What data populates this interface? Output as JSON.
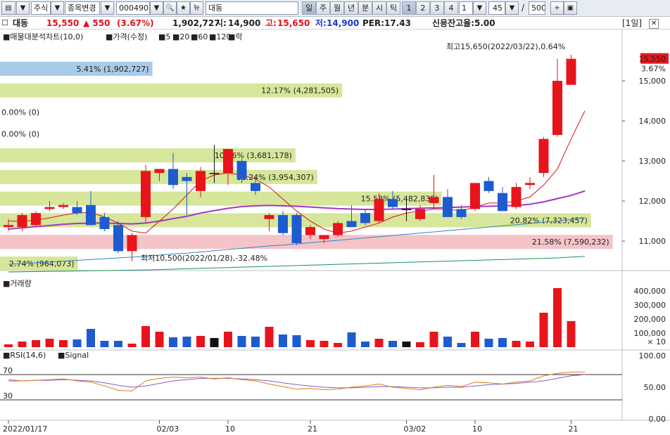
{
  "toolbar": {
    "market": "주식",
    "change_label": "종목변경",
    "code": "000490",
    "name": "대동",
    "periods": [
      "일",
      "주",
      "월",
      "년",
      "분",
      "시",
      "틱"
    ],
    "counts": [
      "1",
      "2",
      "3",
      "4"
    ],
    "interval_value": "1",
    "span_value": "45",
    "separator": "/",
    "total_value": "500"
  },
  "info": {
    "name": "대동",
    "price": "15,550",
    "change": "▲ 550",
    "change_pct": "(3.67%)",
    "volume": "1,902,727",
    "open_label": "시:",
    "open": "14,900",
    "high_label": "고:",
    "high": "15,650",
    "low_label": "저:",
    "low": "14,900",
    "per": "PER:17.43",
    "credit": "신용잔고율:5.00",
    "period_tag": "[1일]"
  },
  "legend": {
    "title": "매물대분석차트(10,0)",
    "price_label": "가격(수정)",
    "ma5": "5",
    "ma20": "20",
    "ma60": "60",
    "ma120": "120",
    "extra": "락"
  },
  "colors": {
    "up": "#e8141c",
    "down": "#1e5bd1",
    "ma5": "#d9141b",
    "ma20": "#a237c4",
    "ma60": "#2f86c6",
    "ma120": "#1a8f5d",
    "zone_green": "#d6e69a",
    "zone_red": "#f4c4c8",
    "zone_blue": "#a9cbe8"
  },
  "price_axis": {
    "ticks": [
      "15,000",
      "14,000",
      "13,000",
      "12,000",
      "11,000"
    ],
    "current": "15,550",
    "current_pct": "3.67%"
  },
  "volume_panel": {
    "title": "거래량",
    "ticks": [
      "400,000",
      "300,000",
      "200,000",
      "100,000"
    ],
    "unit": "× 10"
  },
  "rsi_panel": {
    "title": "RSI(14,6)",
    "signal": "Signal",
    "ticks": [
      "100.00",
      "50.00",
      "0.00"
    ],
    "upper": "70",
    "lower": "30"
  },
  "annotations": {
    "high": "최고15,650(2022/03/22),0.64%",
    "low": "최저10,500(2022/01/28),-32.48%"
  },
  "date_labels": [
    "2022/01/17",
    "02/03",
    "10",
    "21",
    "03/02",
    "10",
    "21"
  ],
  "chart_data": {
    "type": "candlestick",
    "price_range": [
      10300,
      16000
    ],
    "volume_range": [
      0,
      450000
    ],
    "rsi_range": [
      0,
      100
    ],
    "profile": [
      {
        "label": "5.41% (1,902,727)",
        "price": 15300,
        "width": 0.245,
        "color": "blue"
      },
      {
        "label": "12.17% (4,281,505)",
        "price": 14760,
        "width": 0.55,
        "color": "green"
      },
      {
        "label": "0.00% (0)",
        "price": 14220,
        "width": 0,
        "color": "green"
      },
      {
        "label": "0.00% (0)",
        "price": 13680,
        "width": 0,
        "color": "green"
      },
      {
        "label": "10.46% (3,681,178)",
        "price": 13140,
        "width": 0.475,
        "color": "green"
      },
      {
        "label": "11.24% (3,954,307)",
        "price": 12600,
        "width": 0.51,
        "color": "green"
      },
      {
        "label": "15.58% (5,482,835)",
        "price": 12060,
        "width": 0.71,
        "color": "green"
      },
      {
        "label": "20.82% (7,323,457)",
        "price": 11520,
        "width": 0.95,
        "color": "green"
      },
      {
        "label": "21.58% (7,590,232)",
        "price": 10980,
        "width": 0.985,
        "color": "red"
      },
      {
        "label": "2.74% (964,073)",
        "price": 10440,
        "width": 0.125,
        "color": "green"
      }
    ],
    "candles": [
      {
        "o": 11350,
        "h": 11550,
        "l": 11250,
        "c": 11400,
        "v": 20000
      },
      {
        "o": 11350,
        "h": 11700,
        "l": 11250,
        "c": 11650,
        "v": 40000
      },
      {
        "o": 11400,
        "h": 11750,
        "l": 11350,
        "c": 11700,
        "v": 50000
      },
      {
        "o": 11800,
        "h": 12000,
        "l": 11750,
        "c": 11850,
        "v": 60000
      },
      {
        "o": 11850,
        "h": 11950,
        "l": 11800,
        "c": 11900,
        "v": 50000
      },
      {
        "o": 11850,
        "h": 12000,
        "l": 11650,
        "c": 11700,
        "v": 55000
      },
      {
        "o": 11900,
        "h": 12250,
        "l": 11500,
        "c": 11400,
        "v": 130000
      },
      {
        "o": 11600,
        "h": 11700,
        "l": 11250,
        "c": 11300,
        "v": 45000
      },
      {
        "o": 11400,
        "h": 11500,
        "l": 10700,
        "c": 10750,
        "v": 45000
      },
      {
        "o": 10750,
        "h": 11200,
        "l": 10500,
        "c": 11150,
        "v": 25000
      },
      {
        "o": 11600,
        "h": 12900,
        "l": 11450,
        "c": 12750,
        "v": 150000
      },
      {
        "o": 12700,
        "h": 12800,
        "l": 12500,
        "c": 12800,
        "v": 110000
      },
      {
        "o": 12800,
        "h": 13200,
        "l": 12300,
        "c": 12400,
        "v": 70000
      },
      {
        "o": 12600,
        "h": 12700,
        "l": 11650,
        "c": 12500,
        "v": 75000
      },
      {
        "o": 12250,
        "h": 12850,
        "l": 12100,
        "c": 12750,
        "v": 80000
      },
      {
        "o": 12700,
        "h": 13400,
        "l": 12450,
        "c": 12700,
        "v": 65000
      },
      {
        "o": 12700,
        "h": 13300,
        "l": 12400,
        "c": 13300,
        "v": 110000
      },
      {
        "o": 13000,
        "h": 13050,
        "l": 12450,
        "c": 12550,
        "v": 80000
      },
      {
        "o": 12450,
        "h": 12650,
        "l": 12150,
        "c": 12250,
        "v": 75000
      },
      {
        "o": 11550,
        "h": 11700,
        "l": 11250,
        "c": 11650,
        "v": 145000
      },
      {
        "o": 11650,
        "h": 11750,
        "l": 11150,
        "c": 11200,
        "v": 90000
      },
      {
        "o": 11650,
        "h": 11700,
        "l": 10900,
        "c": 10950,
        "v": 85000
      },
      {
        "o": 11150,
        "h": 11400,
        "l": 11050,
        "c": 11350,
        "v": 50000
      },
      {
        "o": 11050,
        "h": 11150,
        "l": 10950,
        "c": 11150,
        "v": 45000
      },
      {
        "o": 11150,
        "h": 11500,
        "l": 11100,
        "c": 11450,
        "v": 30000
      },
      {
        "o": 11500,
        "h": 11900,
        "l": 11350,
        "c": 11350,
        "v": 105000
      },
      {
        "o": 11700,
        "h": 11800,
        "l": 11400,
        "c": 11450,
        "v": 40000
      },
      {
        "o": 11500,
        "h": 12200,
        "l": 11450,
        "c": 12050,
        "v": 60000
      },
      {
        "o": 12050,
        "h": 12250,
        "l": 11800,
        "c": 11850,
        "v": 45000
      },
      {
        "o": 11800,
        "h": 12100,
        "l": 11500,
        "c": 11800,
        "v": 40000
      },
      {
        "o": 11550,
        "h": 11900,
        "l": 11500,
        "c": 11800,
        "v": 35000
      },
      {
        "o": 11950,
        "h": 12650,
        "l": 11800,
        "c": 12100,
        "v": 110000
      },
      {
        "o": 12100,
        "h": 12300,
        "l": 11600,
        "c": 11600,
        "v": 75000
      },
      {
        "o": 11800,
        "h": 11900,
        "l": 11550,
        "c": 11600,
        "v": 30000
      },
      {
        "o": 11800,
        "h": 12450,
        "l": 11750,
        "c": 12450,
        "v": 110000
      },
      {
        "o": 12500,
        "h": 12600,
        "l": 12200,
        "c": 12250,
        "v": 60000
      },
      {
        "o": 12200,
        "h": 12350,
        "l": 11750,
        "c": 11750,
        "v": 65000
      },
      {
        "o": 11850,
        "h": 12450,
        "l": 11800,
        "c": 12350,
        "v": 45000
      },
      {
        "o": 12400,
        "h": 12600,
        "l": 12300,
        "c": 12450,
        "v": 40000
      },
      {
        "o": 12700,
        "h": 13600,
        "l": 12600,
        "c": 13550,
        "v": 245000
      },
      {
        "o": 13650,
        "h": 15550,
        "l": 13600,
        "c": 15000,
        "v": 420000
      },
      {
        "o": 14900,
        "h": 15650,
        "l": 14900,
        "c": 15550,
        "v": 185000
      }
    ],
    "ma5": [
      11500,
      11500,
      11520,
      11580,
      11650,
      11700,
      11720,
      11600,
      11450,
      11250,
      11200,
      11500,
      11800,
      12150,
      12500,
      12650,
      12700,
      12650,
      12550,
      12350,
      12050,
      11750,
      11500,
      11300,
      11200,
      11250,
      11350,
      11450,
      11600,
      11700,
      11750,
      11800,
      11800,
      11750,
      11850,
      11950,
      11950,
      12000,
      12100,
      12400,
      12800,
      13550,
      14250
    ],
    "ma20": [
      11300,
      11330,
      11360,
      11390,
      11420,
      11440,
      11450,
      11450,
      11440,
      11430,
      11450,
      11500,
      11560,
      11620,
      11700,
      11760,
      11820,
      11860,
      11880,
      11890,
      11880,
      11870,
      11850,
      11830,
      11810,
      11800,
      11790,
      11790,
      11800,
      11810,
      11820,
      11830,
      11840,
      11850,
      11860,
      11870,
      11880,
      11890,
      11920,
      11980,
      12060,
      12140,
      12250
    ],
    "ma60": [
      10420,
      10440,
      10460,
      10480,
      10500,
      10520,
      10540,
      10560,
      10580,
      10600,
      10620,
      10650,
      10680,
      10700,
      10730,
      10760,
      10790,
      10820,
      10850,
      10880,
      10900,
      10930,
      10960,
      10990,
      11020,
      11050,
      11080,
      11110,
      11140,
      11170,
      11200,
      11230,
      11260,
      11290,
      11320,
      11350,
      11380,
      11410,
      11440,
      11470,
      11500,
      11540,
      11580
    ],
    "ma120": [
      10230,
      10235,
      10240,
      10245,
      10250,
      10255,
      10260,
      10265,
      10270,
      10275,
      10280,
      10290,
      10300,
      10310,
      10320,
      10330,
      10340,
      10350,
      10360,
      10370,
      10380,
      10390,
      10400,
      10410,
      10420,
      10430,
      10440,
      10450,
      10460,
      10470,
      10480,
      10490,
      10500,
      10510,
      10520,
      10530,
      10540,
      10550,
      10560,
      10570,
      10580,
      10600,
      10620
    ],
    "rsi": [
      62,
      60,
      61,
      62,
      63,
      60,
      58,
      52,
      45,
      44,
      60,
      64,
      66,
      65,
      66,
      63,
      65,
      62,
      60,
      55,
      51,
      47,
      48,
      46,
      47,
      50,
      52,
      55,
      50,
      48,
      46,
      50,
      53,
      51,
      58,
      57,
      55,
      58,
      60,
      68,
      72,
      74,
      74
    ],
    "signal": [
      60,
      60,
      61,
      61,
      62,
      61,
      60,
      57,
      53,
      50,
      52,
      56,
      60,
      62,
      64,
      64,
      64,
      63,
      62,
      60,
      57,
      54,
      52,
      50,
      49,
      49,
      50,
      51,
      51,
      50,
      49,
      49,
      50,
      50,
      52,
      54,
      55,
      56,
      58,
      60,
      64,
      68,
      70
    ]
  }
}
